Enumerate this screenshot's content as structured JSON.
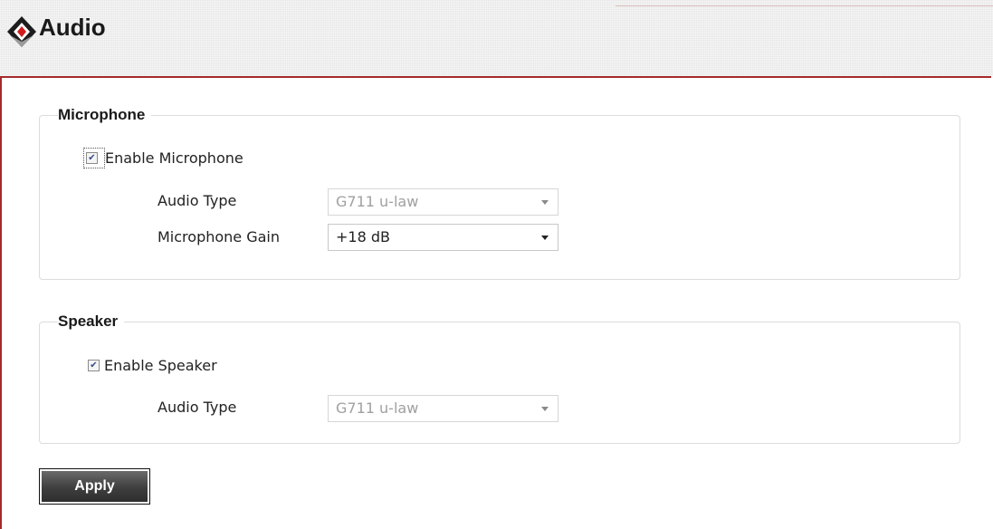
{
  "header": {
    "title": "Audio",
    "logo_icon": "diamond-logo-icon"
  },
  "microphone": {
    "legend": "Microphone",
    "enable_label": "Enable Microphone",
    "enabled": true,
    "audio_type_label": "Audio Type",
    "audio_type_value": "G711 u-law",
    "gain_label": "Microphone Gain",
    "gain_value": "+18 dB"
  },
  "speaker": {
    "legend": "Speaker",
    "enable_label": "Enable Speaker",
    "enabled": true,
    "audio_type_label": "Audio Type",
    "audio_type_value": "G711 u-law"
  },
  "actions": {
    "apply_label": "Apply"
  },
  "colors": {
    "accent_border": "#a52a2a",
    "logo_red": "#d01c1c"
  }
}
